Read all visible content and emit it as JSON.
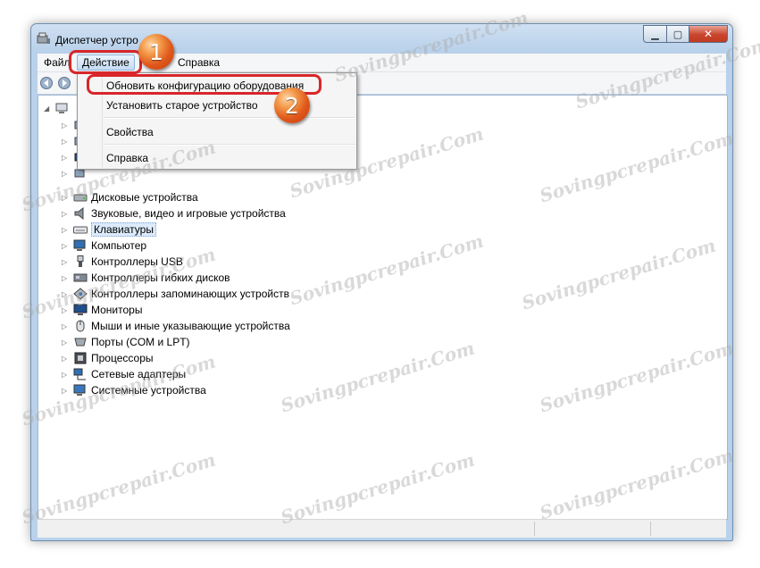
{
  "window": {
    "title": "Диспетчер устро",
    "controls": {
      "minimize": "▁",
      "maximize": "▢",
      "close": "✕"
    }
  },
  "menu": {
    "file": "Файл",
    "action": "Действие",
    "help": "Справка"
  },
  "dropdown": {
    "items": [
      "Обновить конфигурацию оборудования",
      "Установить старое устройство",
      "Свойства",
      "Справка"
    ]
  },
  "tree": {
    "items": [
      "Дисковые устройства",
      "Звуковые, видео и игровые устройства",
      "Клавиатуры",
      "Компьютер",
      "Контроллеры USB",
      "Контроллеры гибких дисков",
      "Контроллеры запоминающих устройств",
      "Мониторы",
      "Мыши и иные указывающие устройства",
      "Порты (COM и LPT)",
      "Процессоры",
      "Сетевые адаптеры",
      "Системные устройства"
    ],
    "selected": "Клавиатуры"
  },
  "annotations": {
    "step1": "1",
    "step2": "2"
  },
  "watermark": "Sovingpcrepair.Com",
  "colors": {
    "highlight": "#d8262a",
    "badge": "#e0571a"
  }
}
